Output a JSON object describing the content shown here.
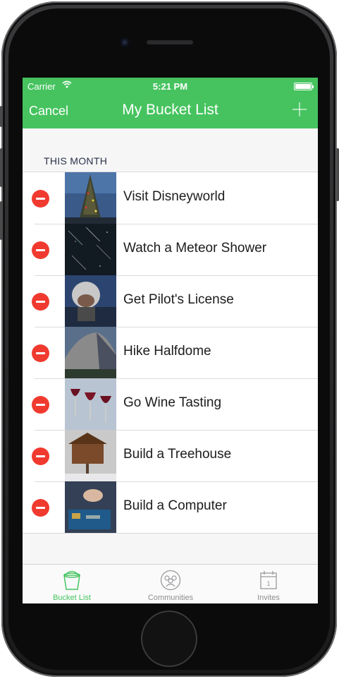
{
  "status_bar": {
    "carrier": "Carrier",
    "time": "5:21 PM"
  },
  "nav": {
    "cancel_label": "Cancel",
    "title": "My Bucket List"
  },
  "section": {
    "header": "THIS MONTH"
  },
  "items": [
    {
      "label": "Visit Disneyworld"
    },
    {
      "label": "Watch a Meteor Shower"
    },
    {
      "label": "Get Pilot's License"
    },
    {
      "label": "Hike Halfdome"
    },
    {
      "label": "Go Wine Tasting"
    },
    {
      "label": "Build a Treehouse"
    },
    {
      "label": "Build a Computer"
    }
  ],
  "tabs": [
    {
      "label": "Bucket List",
      "icon": "bucket-icon",
      "active": true
    },
    {
      "label": "Communities",
      "icon": "people-icon",
      "active": false
    },
    {
      "label": "Invites",
      "icon": "calendar-icon",
      "active": false
    }
  ],
  "calendar_icon_day": "1",
  "colors": {
    "accent": "#46c35f",
    "delete": "#f03a2f"
  }
}
